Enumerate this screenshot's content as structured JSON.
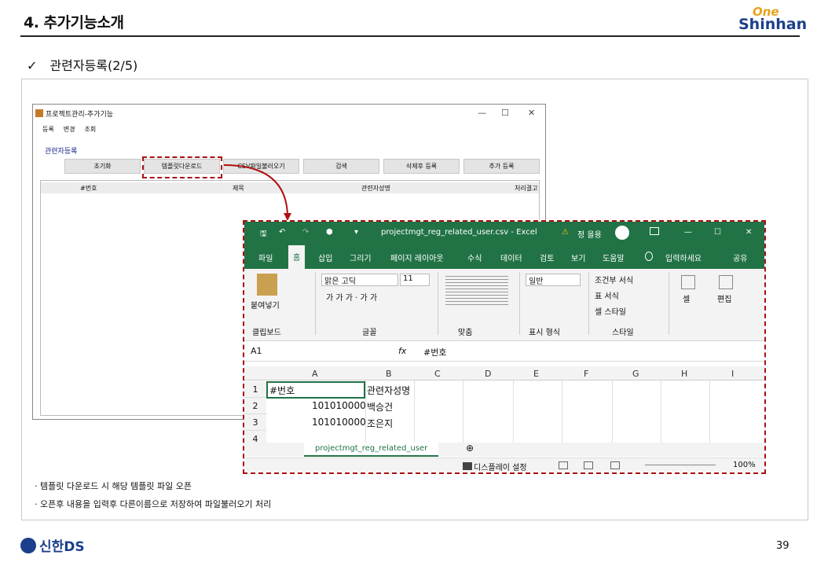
{
  "header": {
    "title": "4. 추가기능소개",
    "logo_one": "One",
    "logo_brand": "Shinhan"
  },
  "subtitle": {
    "check": "✓",
    "text": "관련자등록(2/5)"
  },
  "app": {
    "title": "프로젝트관리-추가기능",
    "controls": [
      "—",
      "☐",
      "✕"
    ],
    "menu": [
      "등록",
      "변경",
      "조회"
    ],
    "section": "관련자등록",
    "buttons": [
      "초기화",
      "템플릿다운로드",
      "CSV파일불러오기",
      "검색",
      "삭제후 등록",
      "추가 등록"
    ],
    "columns": [
      "#번호",
      "제목",
      "관련자성명",
      "처리결고"
    ]
  },
  "excel": {
    "title": "projectmgt_reg_related_user.csv  -  Excel",
    "user": "정 을용",
    "warn": "⚠",
    "win_controls": [
      "—",
      "☐",
      "✕"
    ],
    "quick": [
      "🖫",
      "↶",
      "↷",
      "⬢",
      "▾"
    ],
    "tabs": [
      "파일",
      "홈",
      "삽입",
      "그리기",
      "페이지 레이아웃",
      "수식",
      "데이터",
      "검토",
      "보기",
      "도움말",
      "입력하세요",
      "공유"
    ],
    "ribbon": {
      "paste": "붙여넣기",
      "clipboard": "클립보드",
      "font_name": "맑은 고딕",
      "font_size": "11",
      "font_group": "글꼴",
      "align_group": "맞춤",
      "number_format": "일반",
      "number_group": "표시 형식",
      "cond": "조건부 서식",
      "table": "표 서식",
      "cellstyle": "셀 스타일",
      "style_group": "스타일",
      "cell": "셀",
      "edit": "편집",
      "bold_row": "가 가 가 · 가 가"
    },
    "namebox": "A1",
    "fx": "fx",
    "formula": "#번호",
    "col_headers": [
      "A",
      "B",
      "C",
      "D",
      "E",
      "F",
      "G",
      "H",
      "I"
    ],
    "rows": [
      {
        "num": "1",
        "a": "#번호",
        "b": "관련자성명"
      },
      {
        "num": "2",
        "a": "101010000",
        "b": "백승건"
      },
      {
        "num": "3",
        "a": "101010000",
        "b": "조은지"
      },
      {
        "num": "4",
        "a": "",
        "b": ""
      }
    ],
    "sheet_tab": "projectmgt_reg_related_user",
    "add_sheet": "⊕",
    "status": {
      "display": "디스플레이 설정",
      "zoom": "100%"
    }
  },
  "notes": [
    "템플릿 다운로드 시 해당 템플릿 파일 오픈",
    "오픈후 내용을 입력후 다른이름으로 저장하여 파일불러오기 처리"
  ],
  "footer": {
    "brand": "신한DS",
    "page": "39"
  }
}
